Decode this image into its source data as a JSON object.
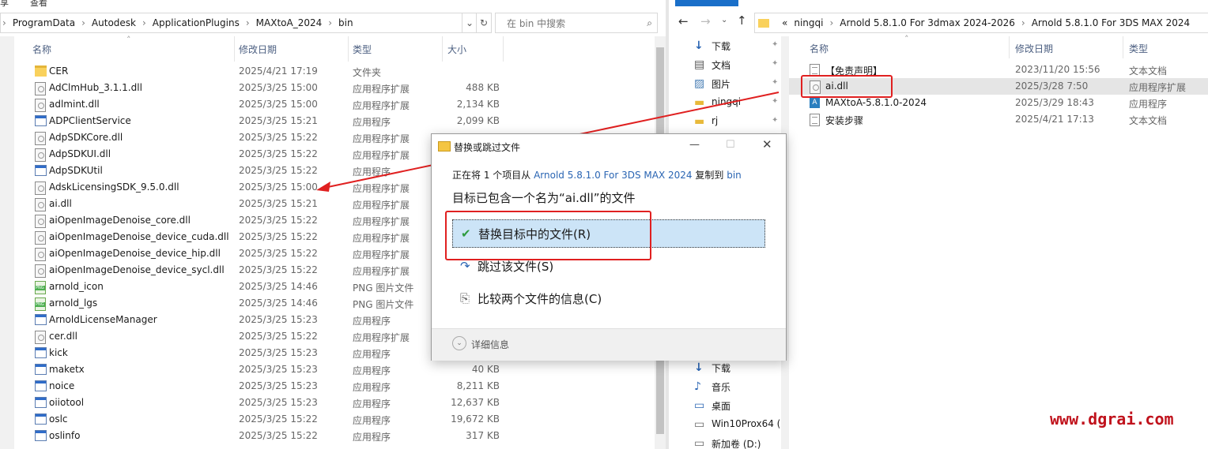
{
  "left": {
    "menu": [
      "享",
      "查看"
    ],
    "path": [
      "ProgramData",
      "Autodesk",
      "ApplicationPlugins",
      "MAXtoA_2024",
      "bin"
    ],
    "search_placeholder": "在 bin 中搜索",
    "columns": {
      "name": "名称",
      "date": "修改日期",
      "type": "类型",
      "size": "大小"
    },
    "files": [
      {
        "icon": "folder-icon",
        "name": "CER",
        "date": "2025/4/21 17:19",
        "type": "文件夹",
        "size": ""
      },
      {
        "icon": "dll-icon",
        "name": "AdClmHub_3.1.1.dll",
        "date": "2025/3/25 15:00",
        "type": "应用程序扩展",
        "size": "488 KB"
      },
      {
        "icon": "dll-icon",
        "name": "adlmint.dll",
        "date": "2025/3/25 15:00",
        "type": "应用程序扩展",
        "size": "2,134 KB"
      },
      {
        "icon": "exe-icon",
        "name": "ADPClientService",
        "date": "2025/3/25 15:21",
        "type": "应用程序",
        "size": "2,099 KB"
      },
      {
        "icon": "dll-icon",
        "name": "AdpSDKCore.dll",
        "date": "2025/3/25 15:22",
        "type": "应用程序扩展",
        "size": ""
      },
      {
        "icon": "dll-icon",
        "name": "AdpSDKUI.dll",
        "date": "2025/3/25 15:22",
        "type": "应用程序扩展",
        "size": ""
      },
      {
        "icon": "exe-icon",
        "name": "AdpSDKUtil",
        "date": "2025/3/25 15:22",
        "type": "应用程序",
        "size": ""
      },
      {
        "icon": "dll-icon",
        "name": "AdskLicensingSDK_9.5.0.dll",
        "date": "2025/3/25 15:00",
        "type": "应用程序扩展",
        "size": ""
      },
      {
        "icon": "dll-icon",
        "name": "ai.dll",
        "date": "2025/3/25 15:21",
        "type": "应用程序扩展",
        "size": ""
      },
      {
        "icon": "dll-icon",
        "name": "aiOpenImageDenoise_core.dll",
        "date": "2025/3/25 15:22",
        "type": "应用程序扩展",
        "size": ""
      },
      {
        "icon": "dll-icon",
        "name": "aiOpenImageDenoise_device_cuda.dll",
        "date": "2025/3/25 15:22",
        "type": "应用程序扩展",
        "size": ""
      },
      {
        "icon": "dll-icon",
        "name": "aiOpenImageDenoise_device_hip.dll",
        "date": "2025/3/25 15:22",
        "type": "应用程序扩展",
        "size": ""
      },
      {
        "icon": "dll-icon",
        "name": "aiOpenImageDenoise_device_sycl.dll",
        "date": "2025/3/25 15:22",
        "type": "应用程序扩展",
        "size": ""
      },
      {
        "icon": "png-icon",
        "name": "arnold_icon",
        "date": "2025/3/25 14:46",
        "type": "PNG 图片文件",
        "size": ""
      },
      {
        "icon": "png-icon",
        "name": "arnold_lgs",
        "date": "2025/3/25 14:46",
        "type": "PNG 图片文件",
        "size": ""
      },
      {
        "icon": "exe-icon",
        "name": "ArnoldLicenseManager",
        "date": "2025/3/25 15:23",
        "type": "应用程序",
        "size": ""
      },
      {
        "icon": "dll-icon",
        "name": "cer.dll",
        "date": "2025/3/25 15:22",
        "type": "应用程序扩展",
        "size": ""
      },
      {
        "icon": "exe-icon",
        "name": "kick",
        "date": "2025/3/25 15:23",
        "type": "应用程序",
        "size": ""
      },
      {
        "icon": "exe-icon",
        "name": "maketx",
        "date": "2025/3/25 15:23",
        "type": "应用程序",
        "size": "40 KB"
      },
      {
        "icon": "exe-icon",
        "name": "noice",
        "date": "2025/3/25 15:23",
        "type": "应用程序",
        "size": "8,211 KB"
      },
      {
        "icon": "exe-icon",
        "name": "oiiotool",
        "date": "2025/3/25 15:23",
        "type": "应用程序",
        "size": "12,637 KB"
      },
      {
        "icon": "exe-icon",
        "name": "oslc",
        "date": "2025/3/25 15:22",
        "type": "应用程序",
        "size": "19,672 KB"
      },
      {
        "icon": "exe-icon",
        "name": "oslinfo",
        "date": "2025/3/25 15:22",
        "type": "应用程序",
        "size": "317 KB"
      }
    ]
  },
  "right": {
    "path_prefix": "«",
    "path": [
      "ningqi",
      "Arnold 5.8.1.0 For 3dmax 2024-2026",
      "Arnold 5.8.1.0 For 3DS MAX 2024"
    ],
    "columns": {
      "name": "名称",
      "date": "修改日期",
      "type": "类型"
    },
    "nav_top": [
      {
        "icon": "download-icon",
        "label": "下载"
      },
      {
        "icon": "document-icon",
        "label": "文档"
      },
      {
        "icon": "picture-icon",
        "label": "图片"
      },
      {
        "icon": "folder-icon",
        "label": "ningqi"
      },
      {
        "icon": "folder-icon",
        "label": "rj"
      }
    ],
    "nav_bottom": [
      {
        "icon": "download-icon",
        "label": "下载"
      },
      {
        "icon": "music-icon",
        "label": "音乐"
      },
      {
        "icon": "desktop-icon",
        "label": "桌面"
      },
      {
        "icon": "drive-icon",
        "label": "Win10Prox64 (("
      },
      {
        "icon": "drive-icon",
        "label": "新加卷 (D:)"
      }
    ],
    "files": [
      {
        "icon": "txt-icon",
        "name": "【免责声明】",
        "date": "2023/11/20 15:56",
        "type": "文本文档"
      },
      {
        "icon": "dll-icon",
        "name": "ai.dll",
        "date": "2025/3/28 7:50",
        "type": "应用程序扩展"
      },
      {
        "icon": "max-icon",
        "name": "MAXtoA-5.8.1.0-2024",
        "date": "2025/3/29 18:43",
        "type": "应用程序"
      },
      {
        "icon": "txt-icon",
        "name": "安装步骤",
        "date": "2025/4/21 17:13",
        "type": "文本文档"
      }
    ]
  },
  "dialog": {
    "title": "替换或跳过文件",
    "line1_prefix": "正在将 1 个项目从",
    "line1_source": "Arnold 5.8.1.0 For 3DS MAX 2024",
    "line1_mid": "复制到",
    "line1_dest": "bin",
    "line2": "目标已包含一个名为“ai.dll”的文件",
    "options": [
      {
        "icon": "checkmark-icon",
        "label": "替换目标中的文件(R)"
      },
      {
        "icon": "skip-icon",
        "label": "跳过该文件(S)"
      },
      {
        "icon": "compare-icon",
        "label": "比较两个文件的信息(C)"
      }
    ],
    "details": "详细信息"
  },
  "watermark": "www.dgrai.com",
  "colors": {
    "highlight": "#e02020",
    "link": "#2a65b3",
    "selected": "#cce4f7"
  }
}
